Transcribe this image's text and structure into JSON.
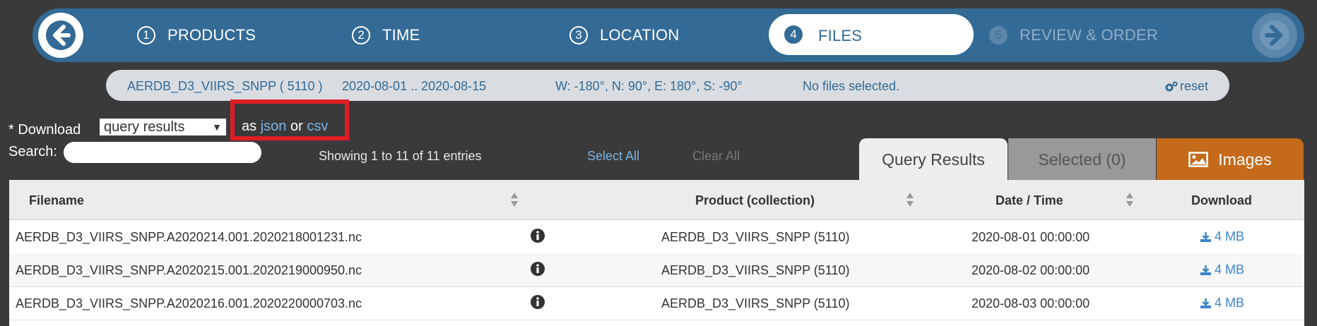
{
  "wizard": {
    "back_icon": "arrow-left-icon",
    "forward_icon": "arrow-right-icon",
    "steps": [
      {
        "num": "1",
        "label": "PRODUCTS"
      },
      {
        "num": "2",
        "label": "TIME"
      },
      {
        "num": "3",
        "label": "LOCATION"
      },
      {
        "num": "4",
        "label": "FILES"
      },
      {
        "num": "5",
        "label": "REVIEW & ORDER"
      }
    ],
    "active_step": 4
  },
  "summary": {
    "product": "AERDB_D3_VIIRS_SNPP ( 5110 )",
    "time_range": "2020-08-01 .. 2020-08-15",
    "location": "W: -180°, N: 90°, E: 180°, S: -90°",
    "selection": "No files selected.",
    "reset_label": "reset"
  },
  "download": {
    "label": "* Download",
    "select_value": "query results",
    "as_text": "as",
    "json_label": "json",
    "or_text": "or",
    "csv_label": "csv"
  },
  "search": {
    "label": "Search:",
    "value": "",
    "placeholder": ""
  },
  "entries_info": "Showing 1 to 11 of 11 entries",
  "select_all": "Select All",
  "clear_all": "Clear All",
  "tabs": {
    "query": "Query Results",
    "selected": "Selected (0)",
    "images": "Images"
  },
  "table": {
    "headers": {
      "filename": "Filename",
      "product": "Product (collection)",
      "date": "Date / Time",
      "download": "Download"
    },
    "rows": [
      {
        "filename": "AERDB_D3_VIIRS_SNPP.A2020214.001.2020218001231.nc",
        "product": "AERDB_D3_VIIRS_SNPP (5110)",
        "date": "2020-08-01 00:00:00",
        "size": "4 MB"
      },
      {
        "filename": "AERDB_D3_VIIRS_SNPP.A2020215.001.2020219000950.nc",
        "product": "AERDB_D3_VIIRS_SNPP (5110)",
        "date": "2020-08-02 00:00:00",
        "size": "4 MB"
      },
      {
        "filename": "AERDB_D3_VIIRS_SNPP.A2020216.001.2020220000703.nc",
        "product": "AERDB_D3_VIIRS_SNPP (5110)",
        "date": "2020-08-03 00:00:00",
        "size": "4 MB"
      }
    ]
  },
  "colors": {
    "background": "#3a3a3a",
    "wizard": "#336a96",
    "accent_link": "#7fb2e5",
    "images_tab": "#c46a1a",
    "highlight_box": "#e01e26"
  }
}
